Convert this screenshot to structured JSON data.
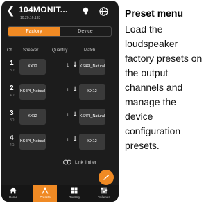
{
  "header": {
    "back_icon": "chevron-left-icon",
    "title": "104MONIT...",
    "ip": "10.20.16.193",
    "bulb_icon": "lightbulb-icon",
    "globe_icon": "globe-icon"
  },
  "tabs": [
    {
      "label": "Factory",
      "active": true
    },
    {
      "label": "Device",
      "active": false
    }
  ],
  "columns": {
    "ch": "Ch.",
    "speaker": "Speaker",
    "quantity": "Quantity",
    "match": "Match"
  },
  "rows": [
    {
      "ch": "1",
      "sub": "8Ω",
      "speaker": "KX12",
      "quantity": "1",
      "match": "KS4PI_Natural"
    },
    {
      "ch": "2",
      "sub": "4Ω",
      "speaker": "KS4PI_Natural",
      "quantity": "1",
      "match": "KX12"
    },
    {
      "ch": "3",
      "sub": "8Ω",
      "speaker": "KX12",
      "quantity": "1",
      "match": "KS4PI_Natural"
    },
    {
      "ch": "4",
      "sub": "4Ω",
      "speaker": "KS4PI_Natural",
      "quantity": "1",
      "match": "KX12"
    }
  ],
  "link_limiter": {
    "label": "Link limiter",
    "icon": "link-icon"
  },
  "fab": {
    "icon": "wand-icon"
  },
  "nav": [
    {
      "label": "Home",
      "icon": "home-icon",
      "active": false
    },
    {
      "label": "Presets",
      "icon": "presets-icon",
      "active": true
    },
    {
      "label": "Routing",
      "icon": "grid-icon",
      "active": false
    },
    {
      "label": "Volumes",
      "icon": "sliders-icon",
      "active": false
    }
  ],
  "info": {
    "title": "Preset menu",
    "body": "Load the loudspeaker factory presets on the output channels and manage the device configuration presets."
  },
  "colors": {
    "accent": "#f08a24",
    "background": "#1c1c1c",
    "cell": "#3a3a3a"
  }
}
